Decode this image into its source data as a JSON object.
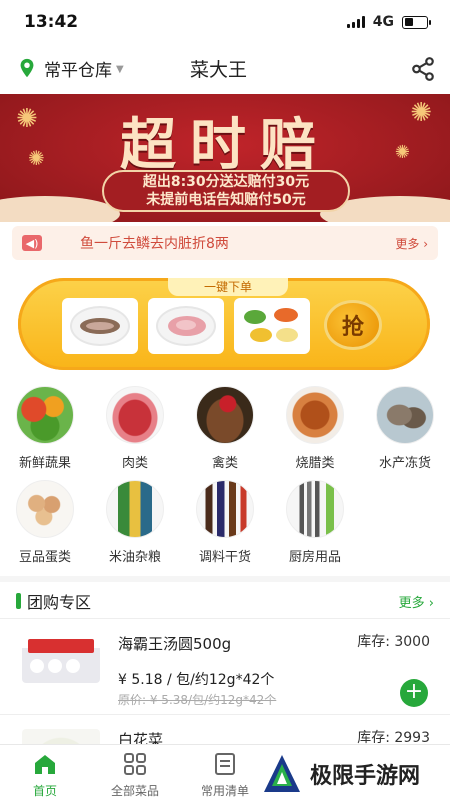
{
  "status": {
    "time": "13:42",
    "network": "4G"
  },
  "header": {
    "warehouse": "常平仓库",
    "title": "菜大王"
  },
  "banner": {
    "headline": "超时赔",
    "line1": "超出8:30分送达赔付30元",
    "line2": "未提前电话告知赔付50元"
  },
  "notice": {
    "text": "鱼一斤去鳞去内脏折8两",
    "more": "更多 ›"
  },
  "quick_order": {
    "label": "一键下单",
    "button": "抢"
  },
  "categories": [
    {
      "label": "新鲜蔬果"
    },
    {
      "label": "肉类"
    },
    {
      "label": "禽类"
    },
    {
      "label": "烧腊类"
    },
    {
      "label": "水产冻货"
    },
    {
      "label": "豆品蛋类"
    },
    {
      "label": "米油杂粮"
    },
    {
      "label": "调料干货"
    },
    {
      "label": "厨房用品"
    }
  ],
  "group_buy": {
    "title": "团购专区",
    "more": "更多 ›",
    "products": [
      {
        "name": "海霸王汤圆500g",
        "stock": "库存:  3000",
        "price": "¥ 5.18 / 包/约12g*42个",
        "original": "原价: ¥ 5.38/包/约12g*42个"
      },
      {
        "name": "白花菜",
        "stock": "库存:  2993"
      }
    ]
  },
  "tabbar": {
    "items": [
      {
        "label": "首页"
      },
      {
        "label": "全部菜品"
      },
      {
        "label": "常用清单"
      }
    ]
  },
  "watermark": {
    "text": "极限手游网"
  },
  "colors": {
    "primary_green": "#27a83b",
    "banner_red": "#9a1b1f",
    "accent_yellow": "#f9b418"
  }
}
